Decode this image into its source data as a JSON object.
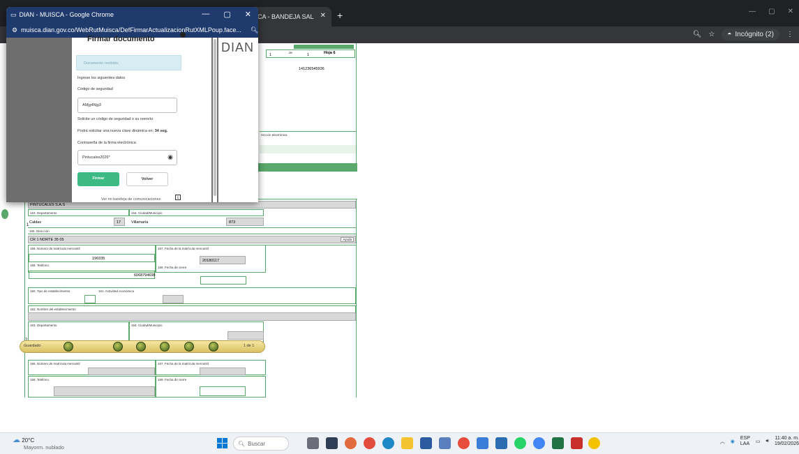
{
  "browser": {
    "bg_tab_title": "SCA - BANDEJA SAL",
    "incognito_label": "Incógnito (2)"
  },
  "popup": {
    "window_title": "DIAN - MUISCA - Google Chrome",
    "url": "muisca.dian.gov.co/WebRutMuisca/DefFirmarActualizacionRutXMLPoup.face...",
    "heading": "Firmar documento",
    "brand": "DIAN",
    "notice": "Documento recibido.",
    "ingrese": "Ingrese los siguientes datos",
    "codigo_label": "Código de seguridad",
    "codigo_value": "AMjg4Njg3",
    "solicite": "Solicite un código de seguridad o su reenvío",
    "podra_prefix": "Podrá solicitar una nueva clave dinámica en:",
    "podra_seconds": "34 seg.",
    "contrasena_label": "Contraseña de la firma electrónica",
    "contrasena_value": "Pintucales2026*",
    "firmar": "Firmar",
    "volver": "Volver",
    "bandeja_link": "Ver mi bandeja de comunicaciones"
  },
  "form": {
    "page_num": "1",
    "de": "de",
    "total": "1",
    "hoja": "Hoja 6",
    "nit": "141236545936",
    "electronico_label": "rección electrónica",
    "company": "PINTUCALES S.A.S",
    "f163": "163. Departamento",
    "f164": "164. Ciudad/Municipio",
    "depto": "Caldas",
    "depto_code": "17",
    "ciudad": "Villamaría",
    "ciudad_code": "873",
    "f165": "165. Dirección",
    "direccion": "CR 1 NORTE  35  05",
    "ayuda": "Ayuda",
    "f166": "166. Número de matrícula mercantil",
    "f167": "167. Fecha de la matrícula mercantil",
    "matricula": "190335",
    "fecha_matricula": "20180117",
    "f168": "168. Teléfono",
    "f169": "169. Fecha de cierre",
    "telefono": "6068794698",
    "f160": "160. Tipo de establecimiento",
    "f161": "161. Actividad económica",
    "f162": "162. Nombre del establecimiento",
    "f163b": "163. Departamento",
    "f164b": "164. Ciudad/Municipio",
    "row_num_1": "1",
    "row_num_2": "2",
    "f166b": "166. Número de matrícula mercantil",
    "f167b": "167. Fecha de la matrícula mercantil",
    "f168b": "168. Teléfono",
    "f169b": "169. Fecha de cierre"
  },
  "floatbar": {
    "status": "Guardado",
    "pages": "1 de 1"
  },
  "taskbar": {
    "temp": "20°C",
    "weather": "Mayorm. nublado",
    "search": "Buscar",
    "lang1": "ESP",
    "lang2": "LAA",
    "time": "11:40 a. m.",
    "date": "19/02/2026"
  }
}
